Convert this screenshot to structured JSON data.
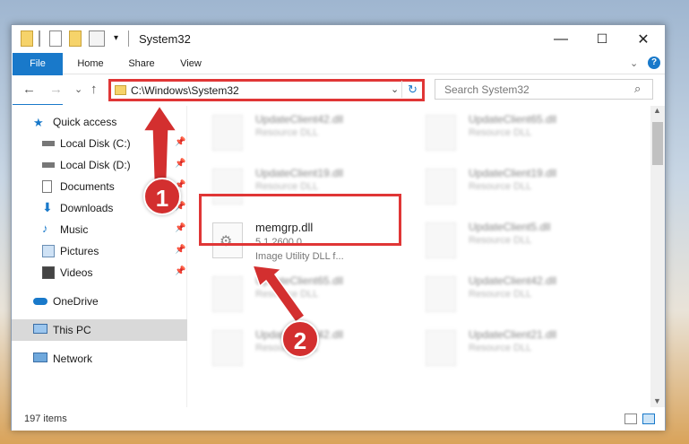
{
  "window": {
    "title": "System32",
    "minimize": "—",
    "maximize": "☐",
    "close": "✕"
  },
  "ribbon": {
    "tabs": [
      "File",
      "Home",
      "Share",
      "View"
    ],
    "help": "?"
  },
  "nav": {
    "back": "←",
    "forward": "→",
    "recent": "⌄",
    "up": "↑",
    "address": "C:\\Windows\\System32",
    "search_placeholder": "Search System32"
  },
  "sidebar": {
    "items": [
      {
        "label": "Quick access",
        "icon": "star-icon"
      },
      {
        "label": "Local Disk (C:)",
        "icon": "drive-icon"
      },
      {
        "label": "Local Disk (D:)",
        "icon": "drive-icon"
      },
      {
        "label": "Documents",
        "icon": "documents-icon"
      },
      {
        "label": "Downloads",
        "icon": "download-icon"
      },
      {
        "label": "Music",
        "icon": "music-icon"
      },
      {
        "label": "Pictures",
        "icon": "pictures-icon"
      },
      {
        "label": "Videos",
        "icon": "videos-icon"
      },
      {
        "label": "OneDrive",
        "icon": "cloud-icon"
      },
      {
        "label": "This PC",
        "icon": "computer-icon"
      },
      {
        "label": "Network",
        "icon": "network-icon"
      }
    ]
  },
  "files": [
    {
      "name": "UpdateClient42.dll",
      "desc": "Resource DLL"
    },
    {
      "name": "UpdateClient65.dll",
      "desc": "Resource DLL"
    },
    {
      "name": "UpdateClient19.dll",
      "desc": "Resource DLL"
    },
    {
      "name": "UpdateClient19.dll",
      "desc": "Resource DLL"
    },
    {
      "name": "UpdateClient5.dll",
      "desc": "Resource DLL"
    },
    {
      "name": "UpdateClient65.dll",
      "desc": "Resource DLL"
    },
    {
      "name": "UpdateClient42.dll",
      "desc": "Resource DLL"
    },
    {
      "name": "UpdateClient42.dll",
      "desc": "Resource DLL"
    },
    {
      "name": "UpdateClient21.dll",
      "desc": "Resource DLL"
    }
  ],
  "selected_file": {
    "name": "memgrp.dll",
    "version": "5.1.2600.0",
    "desc": "Image Utility DLL f..."
  },
  "status": {
    "count": "197 items"
  },
  "annotations": {
    "step1": "1",
    "step2": "2"
  },
  "colors": {
    "accent": "#1979ca",
    "highlight": "#e03636",
    "badge": "#d32f2f"
  }
}
